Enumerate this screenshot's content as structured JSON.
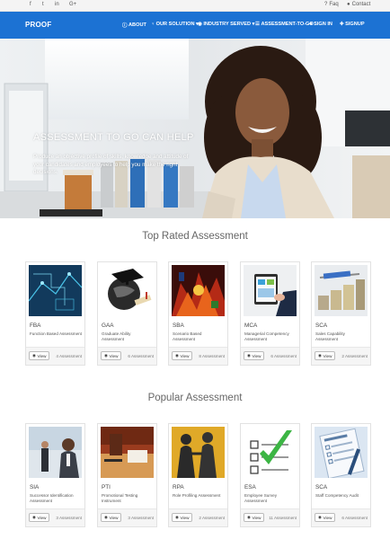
{
  "topbar": {
    "social": [
      "f",
      "t",
      "in",
      "G+"
    ],
    "faq_label": "Faq",
    "contact_label": "Contact"
  },
  "nav": {
    "brand": "PROOF",
    "items": [
      {
        "label": "ABOUT",
        "icon": "info-icon"
      },
      {
        "label": "OUR SOLUTION",
        "icon": "lightbulb-icon",
        "dropdown": true
      },
      {
        "label": "INDUSTRY SERVED",
        "icon": "globe-icon",
        "dropdown": true
      },
      {
        "label": "ASSESSMENT-TO-GO",
        "icon": "list-icon"
      },
      {
        "label": "SIGN IN",
        "icon": "sign-in-icon"
      },
      {
        "label": "SIGNUP",
        "icon": "user-plus-icon"
      }
    ],
    "accent": "#1c72d3"
  },
  "hero": {
    "title": "ASSESSMENT TO GO CAN HELP",
    "text": "Produce an objective profile of skills, knowledge and attitude of your candidates and employees to help you make the right decisions."
  },
  "top_rated": {
    "title": "Top Rated Assessment",
    "cards": [
      {
        "code": "FBA",
        "desc": "Function Based Assessment",
        "view": "View",
        "count": "4 Assessment"
      },
      {
        "code": "GAA",
        "desc": "Graduate Ability Assessment",
        "view": "View",
        "count": "6 Assessment"
      },
      {
        "code": "SBA",
        "desc": "Scenario Based Assessment",
        "view": "View",
        "count": "8 Assessment"
      },
      {
        "code": "MCA",
        "desc": "Managerial Competency Assessment",
        "view": "View",
        "count": "6 Assessment"
      },
      {
        "code": "SCA",
        "desc": "Sales Capability Assessment",
        "view": "View",
        "count": "2 Assessment"
      }
    ]
  },
  "popular": {
    "title": "Popular Assessment",
    "cards": [
      {
        "code": "SIA",
        "desc": "Successor Identification Assessment",
        "view": "View",
        "count": "3 Assessment"
      },
      {
        "code": "PTI",
        "desc": "Promotional Testing Instrument",
        "view": "View",
        "count": "3 Assessment"
      },
      {
        "code": "RPA",
        "desc": "Role Profiling Assessment",
        "view": "View",
        "count": "2 Assessment"
      },
      {
        "code": "ESA",
        "desc": "Employee Survey Assessment",
        "view": "View",
        "count": "11 Assessment"
      },
      {
        "code": "SCA",
        "desc": "Staff Competency Audit",
        "view": "View",
        "count": "6 Assessment"
      }
    ]
  }
}
